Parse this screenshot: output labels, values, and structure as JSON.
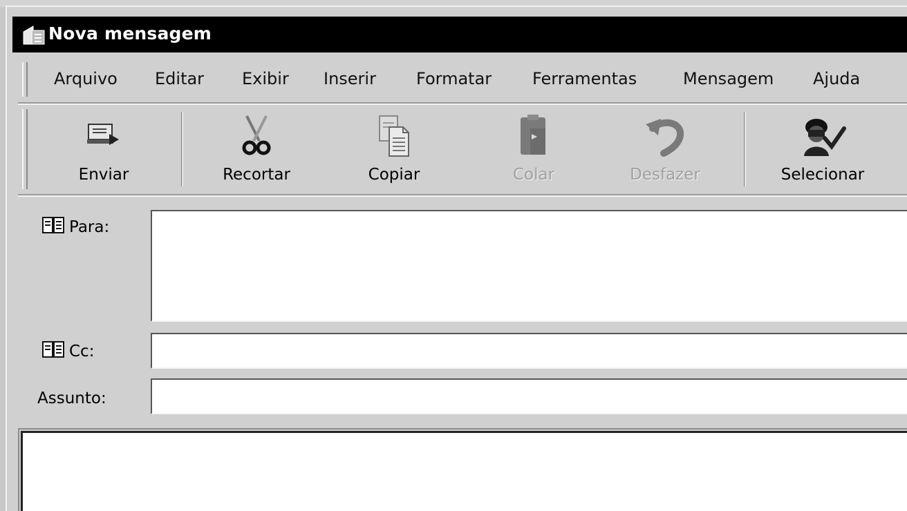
{
  "window": {
    "title": "Nova mensagem"
  },
  "menu": {
    "items": [
      "Arquivo",
      "Editar",
      "Exibir",
      "Inserir",
      "Formatar",
      "Ferramentas",
      "Mensagem",
      "Ajuda"
    ]
  },
  "toolbar": {
    "buttons": [
      {
        "label": "Enviar",
        "icon": "send-icon",
        "enabled": true
      },
      {
        "label": "Recortar",
        "icon": "scissors-icon",
        "enabled": true
      },
      {
        "label": "Copiar",
        "icon": "copy-icon",
        "enabled": true
      },
      {
        "label": "Colar",
        "icon": "paste-icon",
        "enabled": false
      },
      {
        "label": "Desfazer",
        "icon": "undo-icon",
        "enabled": false
      },
      {
        "label": "Selecionar",
        "icon": "select-recipients-icon",
        "enabled": true
      }
    ]
  },
  "header": {
    "to_label": "Para:",
    "to_value": "",
    "cc_label": "Cc:",
    "cc_value": "",
    "subject_label": "Assunto:",
    "subject_value": ""
  },
  "body": {
    "value": ""
  },
  "colors": {
    "titlebar": "#000000",
    "window": "#d0d0d0",
    "disabled_text": "#a0a0a0"
  }
}
